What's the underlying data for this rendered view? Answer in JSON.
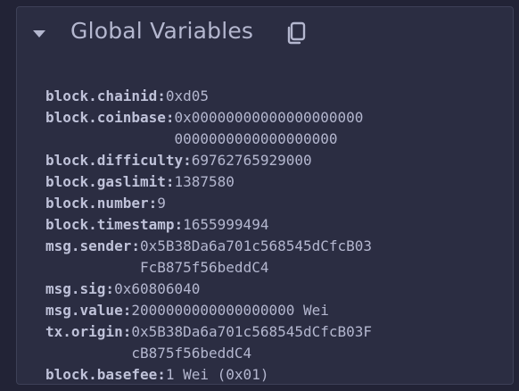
{
  "panel": {
    "title": "Global Variables",
    "icons": {
      "collapse": "caret-down-icon",
      "copy": "copy-icon"
    }
  },
  "variables": [
    {
      "key": "block.chainid:",
      "value": "0xd05"
    },
    {
      "key": "block.coinbase:",
      "value": "0x00000000000000000000\n0000000000000000000"
    },
    {
      "key": "block.difficulty:",
      "value": "69762765929000"
    },
    {
      "key": "block.gaslimit:",
      "value": "1387580"
    },
    {
      "key": "block.number:",
      "value": "9"
    },
    {
      "key": "block.timestamp:",
      "value": "1655999494"
    },
    {
      "key": "msg.sender:",
      "value": "0x5B38Da6a701c568545dCfcB03\nFcB875f56beddC4"
    },
    {
      "key": "msg.sig:",
      "value": "0x60806040"
    },
    {
      "key": "msg.value:",
      "value": "2000000000000000000 Wei"
    },
    {
      "key": "tx.origin:",
      "value": "0x5B38Da6a701c568545dCfcB03F\ncB875f56beddC4"
    },
    {
      "key": "block.basefee:",
      "value": "1 Wei (0x01)"
    }
  ]
}
